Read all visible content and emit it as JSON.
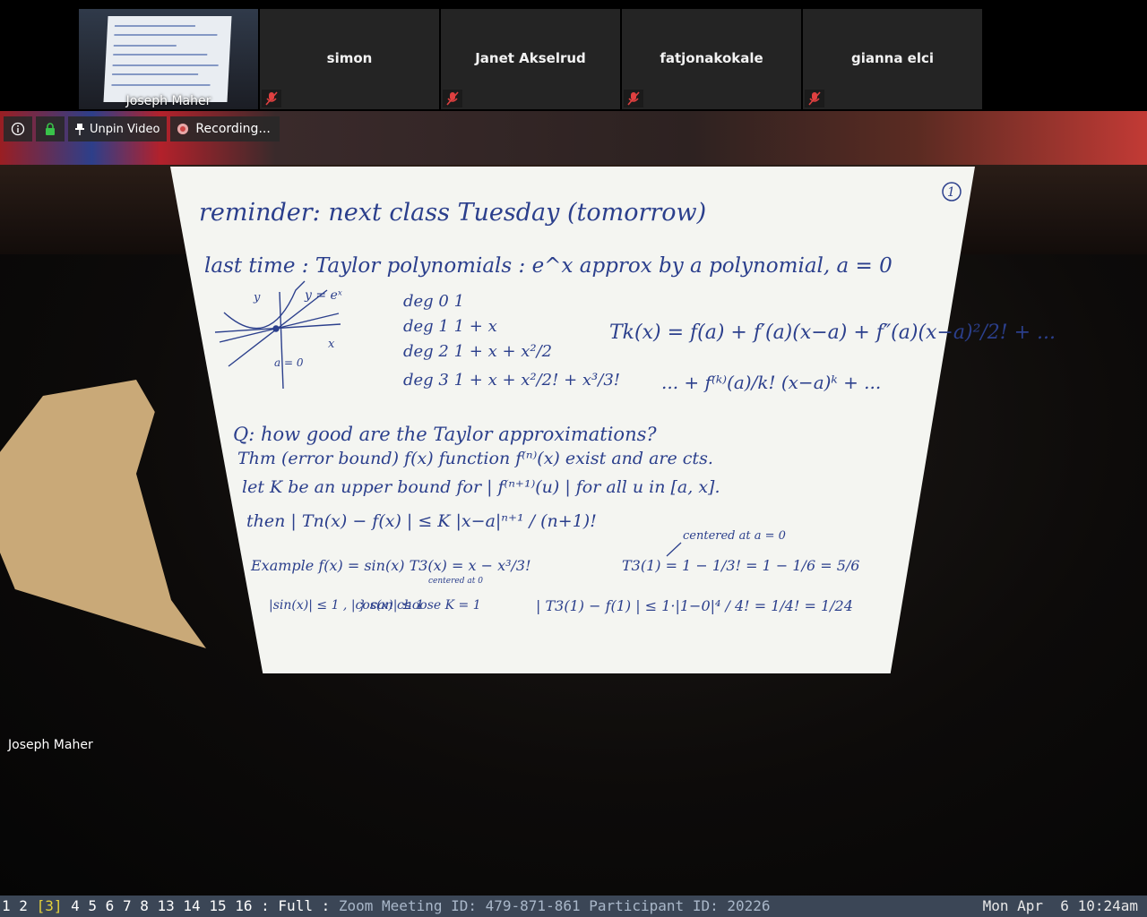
{
  "participants": [
    {
      "name": "Joseph Maher",
      "self": true
    },
    {
      "name": "simon",
      "muted": true
    },
    {
      "name": "Janet Akselrud",
      "muted": true
    },
    {
      "name": "fatjonakokale",
      "muted": true
    },
    {
      "name": "gianna elci",
      "muted": true
    }
  ],
  "video_toolbar": {
    "info_icon": "info-icon",
    "lock_icon": "lock-icon",
    "unpin_label": "Unpin Video",
    "recording_label": "Recording..."
  },
  "active_speaker": "Joseph Maher",
  "whiteboard": {
    "page_number": "1",
    "line1": "reminder: next class Tuesday (tomorrow)",
    "line2": "last time : Taylor polynomials : e^x approx by a polynomial, a = 0",
    "deg0": "deg 0   1",
    "deg1": "deg 1   1 + x",
    "deg2": "deg 2   1 + x + x²/2",
    "deg3": "deg 3   1 + x + x²/2! + x³/3!",
    "graph_label_y": "y",
    "graph_label_curve": "y = eˣ",
    "graph_label_x": "x",
    "graph_label_a": "a = 0",
    "taylor_formula_1": "Tk(x) = f(a) + f′(a)(x−a) + f″(a)(x−a)²/2! + ...",
    "taylor_formula_2": "... + f⁽ᵏ⁾(a)/k! (x−a)ᵏ + ...",
    "question": "Q: how good are the Taylor approximations?",
    "theorem": "Thm (error bound)  f(x) function  f⁽ⁿ⁾(x) exist and are cts.",
    "let_k": "let K be an upper bound for | f⁽ⁿ⁺¹⁾(u) | for all u in [a, x].",
    "then": "then | Tn(x) − f(x) | ≤ K |x−a|ⁿ⁺¹ / (n+1)!",
    "centered_note": "centered at a = 0",
    "example": "Example   f(x) = sin(x)    T3(x) = x − x³/3!",
    "centered_small": "centered at 0",
    "t3_eval": "T3(1) = 1 − 1/3! = 1 − 1/6 = 5/6",
    "bounds": "|sin(x)| ≤ 1 ,  |cos(x)| ≤ 1",
    "choose_k": "} can choose K = 1",
    "error_eval": "| T3(1) − f(1) | ≤ 1·|1−0|⁴ / 4! = 1/4! = 1/24"
  },
  "statusbar": {
    "workspaces": [
      "1",
      "2",
      "[3]",
      "4",
      "5",
      "6",
      "7",
      "8",
      "13",
      "14",
      "15",
      "16"
    ],
    "active_workspace": "[3]",
    "separator": ":",
    "layout": "Full",
    "window_title": "Zoom Meeting ID: 479-871-861 Participant ID: 20226",
    "clock": "Mon Apr  6 10:24am"
  },
  "colors": {
    "ink": "#2b3f8c",
    "statusbar_bg": "#3b4656",
    "active_workspace": "#e6d23a",
    "tile_bg": "#242424"
  }
}
